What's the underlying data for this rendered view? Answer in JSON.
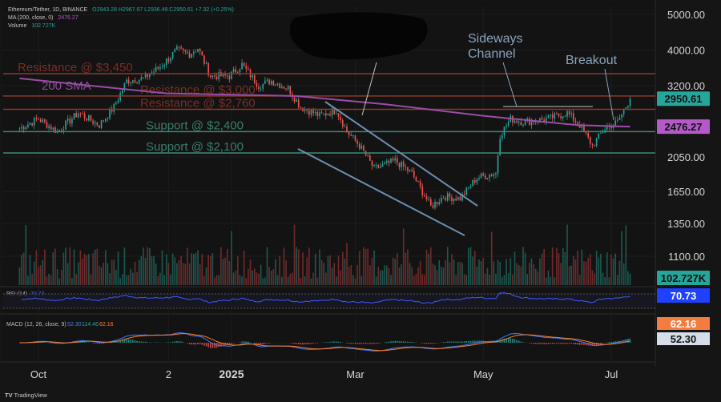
{
  "header": {
    "symbol_line": "Ethereum/Tether, 1D, BINANCE",
    "ohlc": "O2943.28 H2967.97 L2936.49 C2950.61 +7.32 (+0.25%)",
    "ma_label": "MA (200, close, 0)",
    "ma_value": "2476.27",
    "volume_label": "Volume",
    "volume_value": "102.727K"
  },
  "watermark": "TradingView",
  "chart_data": {
    "type": "candlestick",
    "y_scale": "log",
    "ylim": [
      1100,
      5000
    ],
    "y_ticks": [
      "5000.00",
      "4000.00",
      "3200.00",
      "2050.00",
      "1650.00",
      "1350.00",
      "1100.00"
    ],
    "x_ticks": [
      "Oct",
      "2",
      "2025",
      "Mar",
      "May",
      "Jul"
    ],
    "ohlc_anchor_closes": [
      [
        "Sep 22",
        2450
      ],
      [
        "Oct 1",
        2600
      ],
      [
        "Oct 10",
        2400
      ],
      [
        "Oct 20",
        2700
      ],
      [
        "Oct 30",
        2500
      ],
      [
        "Nov 6",
        2800
      ],
      [
        "Nov 12",
        3300
      ],
      [
        "Nov 20",
        3350
      ],
      [
        "Nov 28",
        3600
      ],
      [
        "Dec 6",
        4000
      ],
      [
        "Dec 12",
        3900
      ],
      [
        "Dec 16",
        4050
      ],
      [
        "Dec 22",
        3400
      ],
      [
        "Dec 31",
        3400
      ],
      [
        "Jan 6",
        3650
      ],
      [
        "Jan 14",
        3200
      ],
      [
        "Jan 20",
        3300
      ],
      [
        "Jan 28",
        3150
      ],
      [
        "Feb 3",
        2800
      ],
      [
        "Feb 12",
        2650
      ],
      [
        "Feb 20",
        2750
      ],
      [
        "Feb 25",
        2400
      ],
      [
        "Mar 3",
        2200
      ],
      [
        "Mar 10",
        1900
      ],
      [
        "Mar 20",
        2000
      ],
      [
        "Mar 28",
        1850
      ],
      [
        "Apr 6",
        1500
      ],
      [
        "Apr 12",
        1600
      ],
      [
        "Apr 20",
        1580
      ],
      [
        "Apr 28",
        1800
      ],
      [
        "May 7",
        1850
      ],
      [
        "May 9",
        2350
      ],
      [
        "May 14",
        2600
      ],
      [
        "May 20",
        2550
      ],
      [
        "Jun 1",
        2600
      ],
      [
        "Jun 10",
        2700
      ],
      [
        "Jun 16",
        2500
      ],
      [
        "Jun 22",
        2200
      ],
      [
        "Jun 28",
        2450
      ],
      [
        "Jul 4",
        2550
      ],
      [
        "Jul 10",
        2950
      ]
    ],
    "last_price": 2950.61,
    "sma200": {
      "name": "200 SMA",
      "last": 2476.27,
      "points": [
        [
          "Sep 22",
          3350
        ],
        [
          "Dec 1",
          3050
        ],
        [
          "Feb 1",
          3000
        ],
        [
          "Mar 15",
          2850
        ],
        [
          "May 1",
          2650
        ],
        [
          "Jun 15",
          2500
        ],
        [
          "Jul 10",
          2476.27
        ]
      ]
    },
    "levels": [
      {
        "label": "Resistance @ $3,450",
        "price": 3450,
        "kind": "resistance"
      },
      {
        "label": "Resistance @ $3,000",
        "price": 3000,
        "kind": "resistance"
      },
      {
        "label": "Resistance @ $2,760",
        "price": 2760,
        "kind": "resistance"
      },
      {
        "label": "Support @ $2,400",
        "price": 2400,
        "kind": "support"
      },
      {
        "label": "Support @ $2,100",
        "price": 2100,
        "kind": "support"
      }
    ],
    "annotations": [
      "Sideways\nChannel",
      "Breakout"
    ],
    "volume": {
      "last": "102.727K"
    },
    "rsi": {
      "label": "RSI (14)",
      "value": 70.73,
      "upper": 70,
      "lower": 30
    },
    "macd": {
      "label": "MACD (12, 26, close, 9)",
      "macd": 52.3,
      "signal": 62.16,
      "hist": 114.46
    }
  },
  "colors": {
    "up": "#26a69a",
    "down": "#ef5350",
    "sma": "#9c4ba8",
    "resistance": "#8b3a2c",
    "support": "#3f8a78",
    "channel": "#6b8fb3",
    "annot": "#8aa3bd",
    "price_tag": "#26a69a",
    "sma_tag": "#b45ac8",
    "rsi_line": "#3d5afe",
    "rsi_tag": "#1e40ff",
    "macd_line": "#3d7dff",
    "signal_line": "#ff7e22",
    "signal_tag": "#f57c3f"
  }
}
